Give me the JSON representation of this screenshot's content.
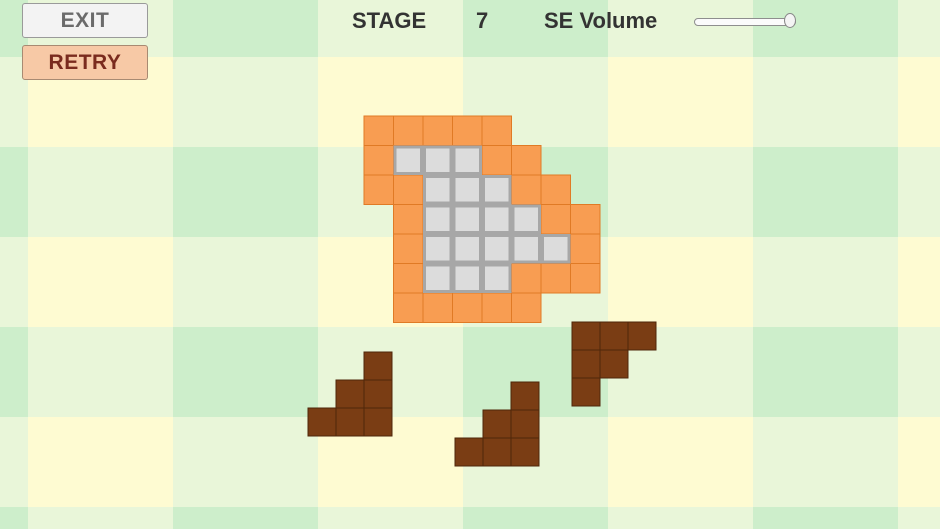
{
  "buttons": {
    "exit_label": "EXIT",
    "retry_label": "RETRY"
  },
  "hud": {
    "stage_label": "STAGE",
    "stage_number": "7",
    "volume_label": "SE Volume",
    "volume_level": 1.0
  },
  "colors": {
    "bg_yellow": "#fefbd2",
    "bg_green": "#cdeecb",
    "bg_light": "#e9f6d9",
    "frame_orange": "#f89d52",
    "frame_orange_dark": "#e07a25",
    "target_gray": "#dcdcdc",
    "target_gray_border": "#a7a7a7",
    "piece_brown": "#7a3d14",
    "piece_brown_dark": "#4f260a"
  },
  "puzzle": {
    "frame_cells": [
      [
        0,
        0
      ],
      [
        1,
        0
      ],
      [
        2,
        0
      ],
      [
        3,
        0
      ],
      [
        4,
        0
      ],
      [
        0,
        1
      ],
      [
        4,
        1
      ],
      [
        5,
        1
      ],
      [
        0,
        2
      ],
      [
        1,
        2
      ],
      [
        5,
        2
      ],
      [
        6,
        2
      ],
      [
        1,
        3
      ],
      [
        6,
        3
      ],
      [
        7,
        3
      ],
      [
        1,
        4
      ],
      [
        7,
        4
      ],
      [
        1,
        5
      ],
      [
        5,
        5
      ],
      [
        6,
        5
      ],
      [
        7,
        5
      ],
      [
        1,
        6
      ],
      [
        2,
        6
      ],
      [
        3,
        6
      ],
      [
        4,
        6
      ],
      [
        5,
        6
      ]
    ],
    "target_cells": [
      [
        1,
        1
      ],
      [
        2,
        1
      ],
      [
        3,
        1
      ],
      [
        2,
        2
      ],
      [
        3,
        2
      ],
      [
        4,
        2
      ],
      [
        2,
        3
      ],
      [
        3,
        3
      ],
      [
        4,
        3
      ],
      [
        5,
        3
      ],
      [
        2,
        4
      ],
      [
        3,
        4
      ],
      [
        4,
        4
      ],
      [
        5,
        4
      ],
      [
        6,
        4
      ],
      [
        2,
        5
      ],
      [
        3,
        5
      ],
      [
        4,
        5
      ]
    ]
  },
  "pieces": [
    {
      "cells": [
        [
          2,
          0
        ],
        [
          1,
          1
        ],
        [
          2,
          1
        ],
        [
          0,
          2
        ],
        [
          1,
          2
        ],
        [
          2,
          2
        ]
      ]
    },
    {
      "cells": [
        [
          2,
          0
        ],
        [
          1,
          1
        ],
        [
          2,
          1
        ],
        [
          0,
          2
        ],
        [
          1,
          2
        ],
        [
          2,
          2
        ]
      ]
    },
    {
      "cells": [
        [
          0,
          0
        ],
        [
          1,
          0
        ],
        [
          2,
          0
        ],
        [
          0,
          1
        ],
        [
          1,
          1
        ],
        [
          0,
          2
        ]
      ]
    }
  ]
}
